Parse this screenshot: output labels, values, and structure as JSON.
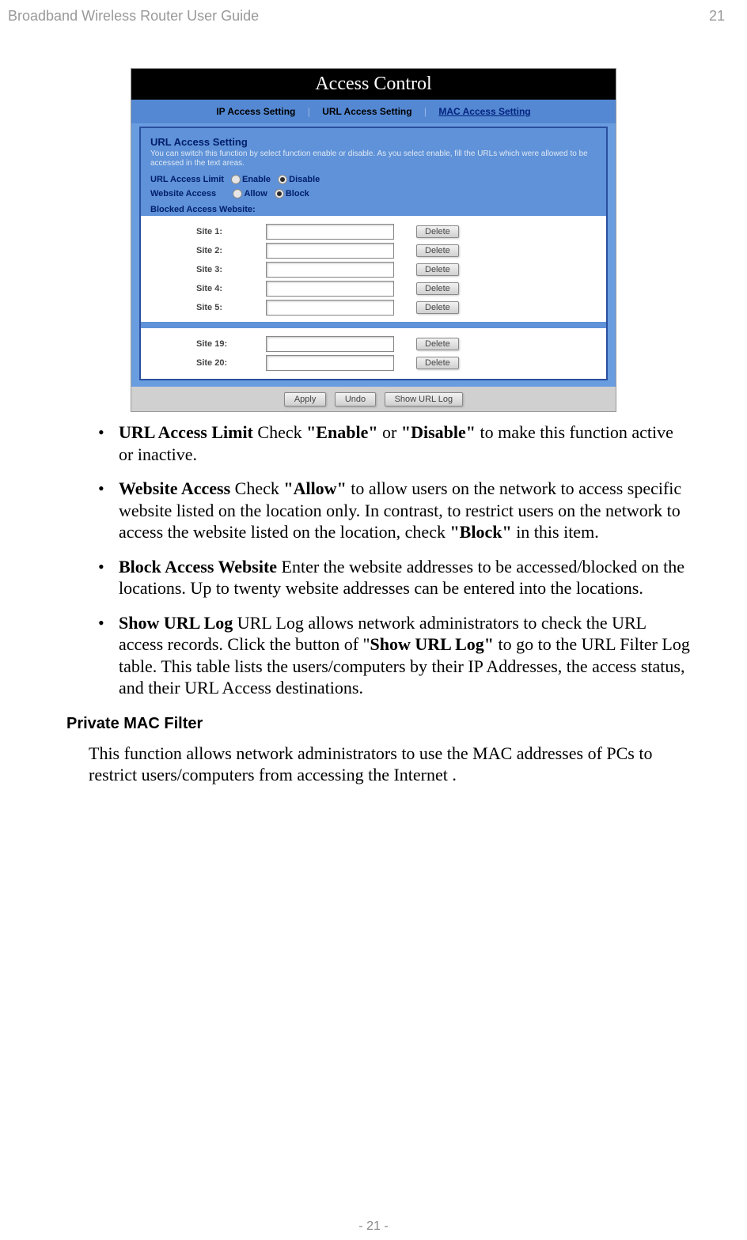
{
  "header": {
    "title": "Broadband Wireless Router User Guide",
    "page": "21"
  },
  "footer": {
    "page": "- 21 -"
  },
  "screenshot": {
    "title": "Access Control",
    "tabs": {
      "ip": "IP Access Setting",
      "url": "URL Access Setting",
      "mac": "MAC Access Setting"
    },
    "panel": {
      "heading": "URL Access Setting",
      "desc": "You can switch this function by select function enable or disable. As you select enable, fill the URLs which were allowed to be accessed in the text areas.",
      "limit_label": "URL Access Limit",
      "limit_enable": "Enable",
      "limit_disable": "Disable",
      "access_label": "Website Access",
      "access_allow": "Allow",
      "access_block": "Block",
      "blocked_label": "Blocked Access Website:",
      "sites": [
        {
          "label": "Site 1:",
          "btn": "Delete"
        },
        {
          "label": "Site 2:",
          "btn": "Delete"
        },
        {
          "label": "Site 3:",
          "btn": "Delete"
        },
        {
          "label": "Site 4:",
          "btn": "Delete"
        },
        {
          "label": "Site 5:",
          "btn": "Delete"
        }
      ],
      "sites2": [
        {
          "label": "Site 19:",
          "btn": "Delete"
        },
        {
          "label": "Site 20:",
          "btn": "Delete"
        }
      ]
    },
    "buttons": {
      "apply": "Apply",
      "undo": "Undo",
      "showlog": "Show URL Log"
    }
  },
  "bullets": {
    "b1a": "URL Access Limit",
    "b1b": " Check ",
    "b1c": "\"Enable\"",
    "b1d": " or ",
    "b1e": "\"Disable\"",
    "b1f": " to make this function active or inactive.",
    "b2a": "Website Access",
    "b2b": " Check ",
    "b2c": "\"Allow\"",
    "b2d": " to allow users on the network to access specific website listed on the location only. In contrast, to restrict users on the network to access the website listed on the location, check ",
    "b2e": "\"Block\"",
    "b2f": " in this item.",
    "b3a": "Block Access Website",
    "b3b": " Enter the website addresses to be accessed/blocked on the locations. Up to twenty website addresses can be entered into the locations.",
    "b4a": "Show URL Log",
    "b4b": " URL Log allows network administrators to check the URL access records. Click the button of \"",
    "b4c": "Show URL Log\"",
    "b4d": " to go to the URL Filter Log table. This table lists the users/computers by their IP Addresses, the access status, and their URL Access destinations."
  },
  "subhead": "Private MAC Filter",
  "subtext": "This function allows network administrators to use the MAC addresses of PCs to restrict users/computers from accessing the Internet ."
}
